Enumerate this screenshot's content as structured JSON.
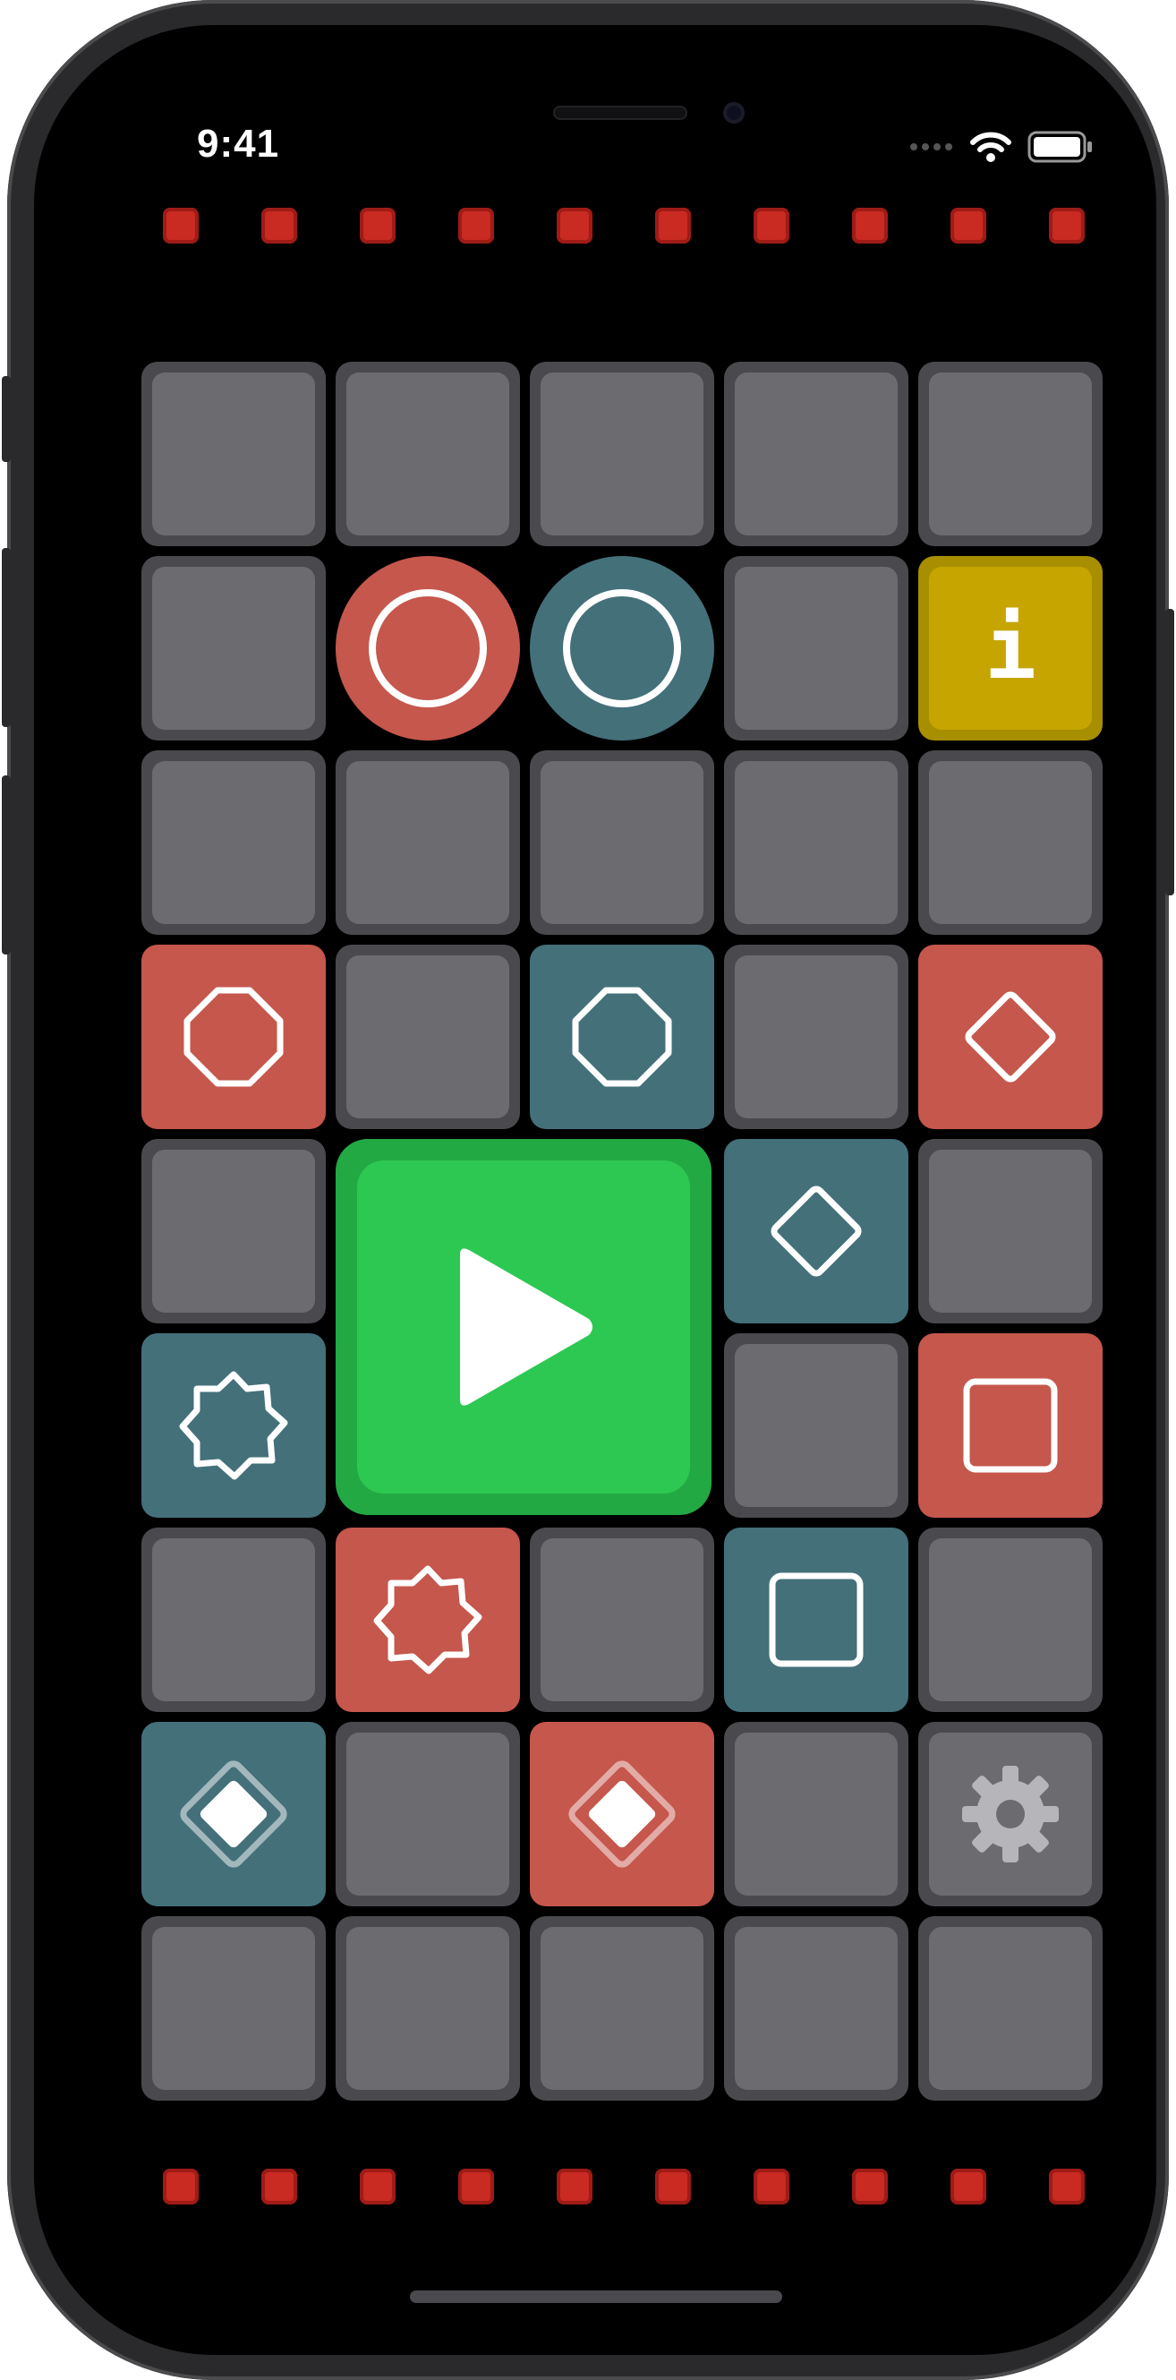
{
  "status_bar": {
    "time": "9:41",
    "icons": [
      "signal-dots-icon",
      "wifi-icon",
      "battery-icon"
    ]
  },
  "led_rows": {
    "top_count": 10,
    "bottom_count": 10,
    "color": "#c92a22"
  },
  "grid": {
    "columns": 5,
    "rows": 9,
    "cells": [
      [
        "gray",
        "gray",
        "gray",
        "gray",
        "gray"
      ],
      [
        "gray",
        "red-circle",
        "teal-circle",
        "gray",
        "info"
      ],
      [
        "gray",
        "gray",
        "gray",
        "gray",
        "gray"
      ],
      [
        "red-octagon",
        "gray",
        "teal-octagon",
        "gray",
        "red-diamond"
      ],
      [
        "gray",
        "play",
        "play",
        "teal-diamond",
        "gray"
      ],
      [
        "teal-star",
        "play",
        "play",
        "gray",
        "red-square"
      ],
      [
        "gray",
        "red-star",
        "gray",
        "teal-square",
        "gray"
      ],
      [
        "teal-diamond-filled",
        "gray",
        "red-diamond-filled",
        "gray",
        "settings"
      ],
      [
        "gray",
        "gray",
        "gray",
        "gray",
        "gray"
      ]
    ]
  },
  "info_button": {
    "label": "i"
  },
  "play_button": {
    "icon": "play-icon"
  },
  "settings_button": {
    "icon": "gear-icon"
  },
  "colors": {
    "red": "#c5574d",
    "teal": "#44707a",
    "yellow": "#c6a500",
    "green": "#2dc852",
    "gray": "#6c6b70"
  }
}
